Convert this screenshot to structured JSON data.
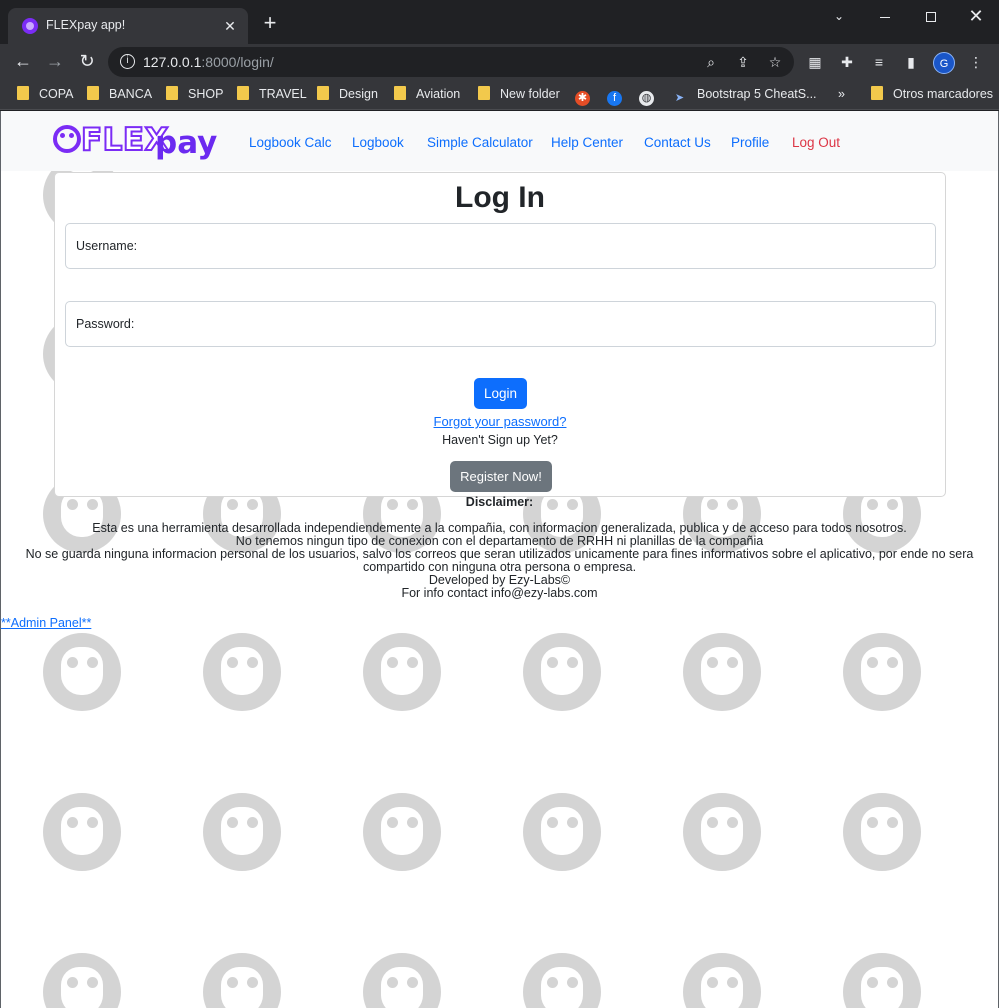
{
  "browser": {
    "tab_title": "FLEXpay app!",
    "url_host": "127.0.0.1",
    "url_path": ":8000/login/",
    "bookmarks": [
      "COPA",
      "BANCA",
      "SHOP",
      "TRAVEL",
      "Design",
      "Aviation",
      "New folder",
      "Bootstrap 5 CheatS...",
      "Otros marcadores"
    ],
    "avatar_letter": "G"
  },
  "navbar": {
    "logo_flex": "FLEX",
    "logo_pay": "pay",
    "links": [
      "Logbook Calc",
      "Logbook",
      "Simple Calculator",
      "Help Center",
      "Contact Us",
      "Profile"
    ],
    "logout": "Log Out"
  },
  "login": {
    "title": "Log In",
    "username_label": "Username:",
    "password_label": "Password:",
    "login_button": "Login",
    "forgot_link": "Forgot your password?",
    "no_signup_text": "Haven't Sign up Yet?",
    "register_button": "Register Now!"
  },
  "footer": {
    "disclaimer_title": "Disclaimer:",
    "line1": "Esta es una herramienta desarrollada independiendemente a la compañia, con informacion generalizada, publica y de acceso para todos nosotros.",
    "line2": "No tenemos ningun tipo de conexion con el departamento de RRHH ni planillas de la compañia",
    "line3": "No se guarda ninguna informacion personal de los usuarios, salvo los correos que seran utilizados unicamente para fines informativos sobre el aplicativo, por ende no sera compartido con ninguna otra persona o empresa.",
    "developed_by": "Developed by Ezy-Labs©",
    "contact": "For info contact info@ezy-labs.com",
    "admin_link": "**Admin Panel**"
  },
  "colors": {
    "primary": "#0d6efd",
    "danger": "#dc3545",
    "secondary": "#6c757d",
    "brand_purple": "#7b2cf5"
  }
}
